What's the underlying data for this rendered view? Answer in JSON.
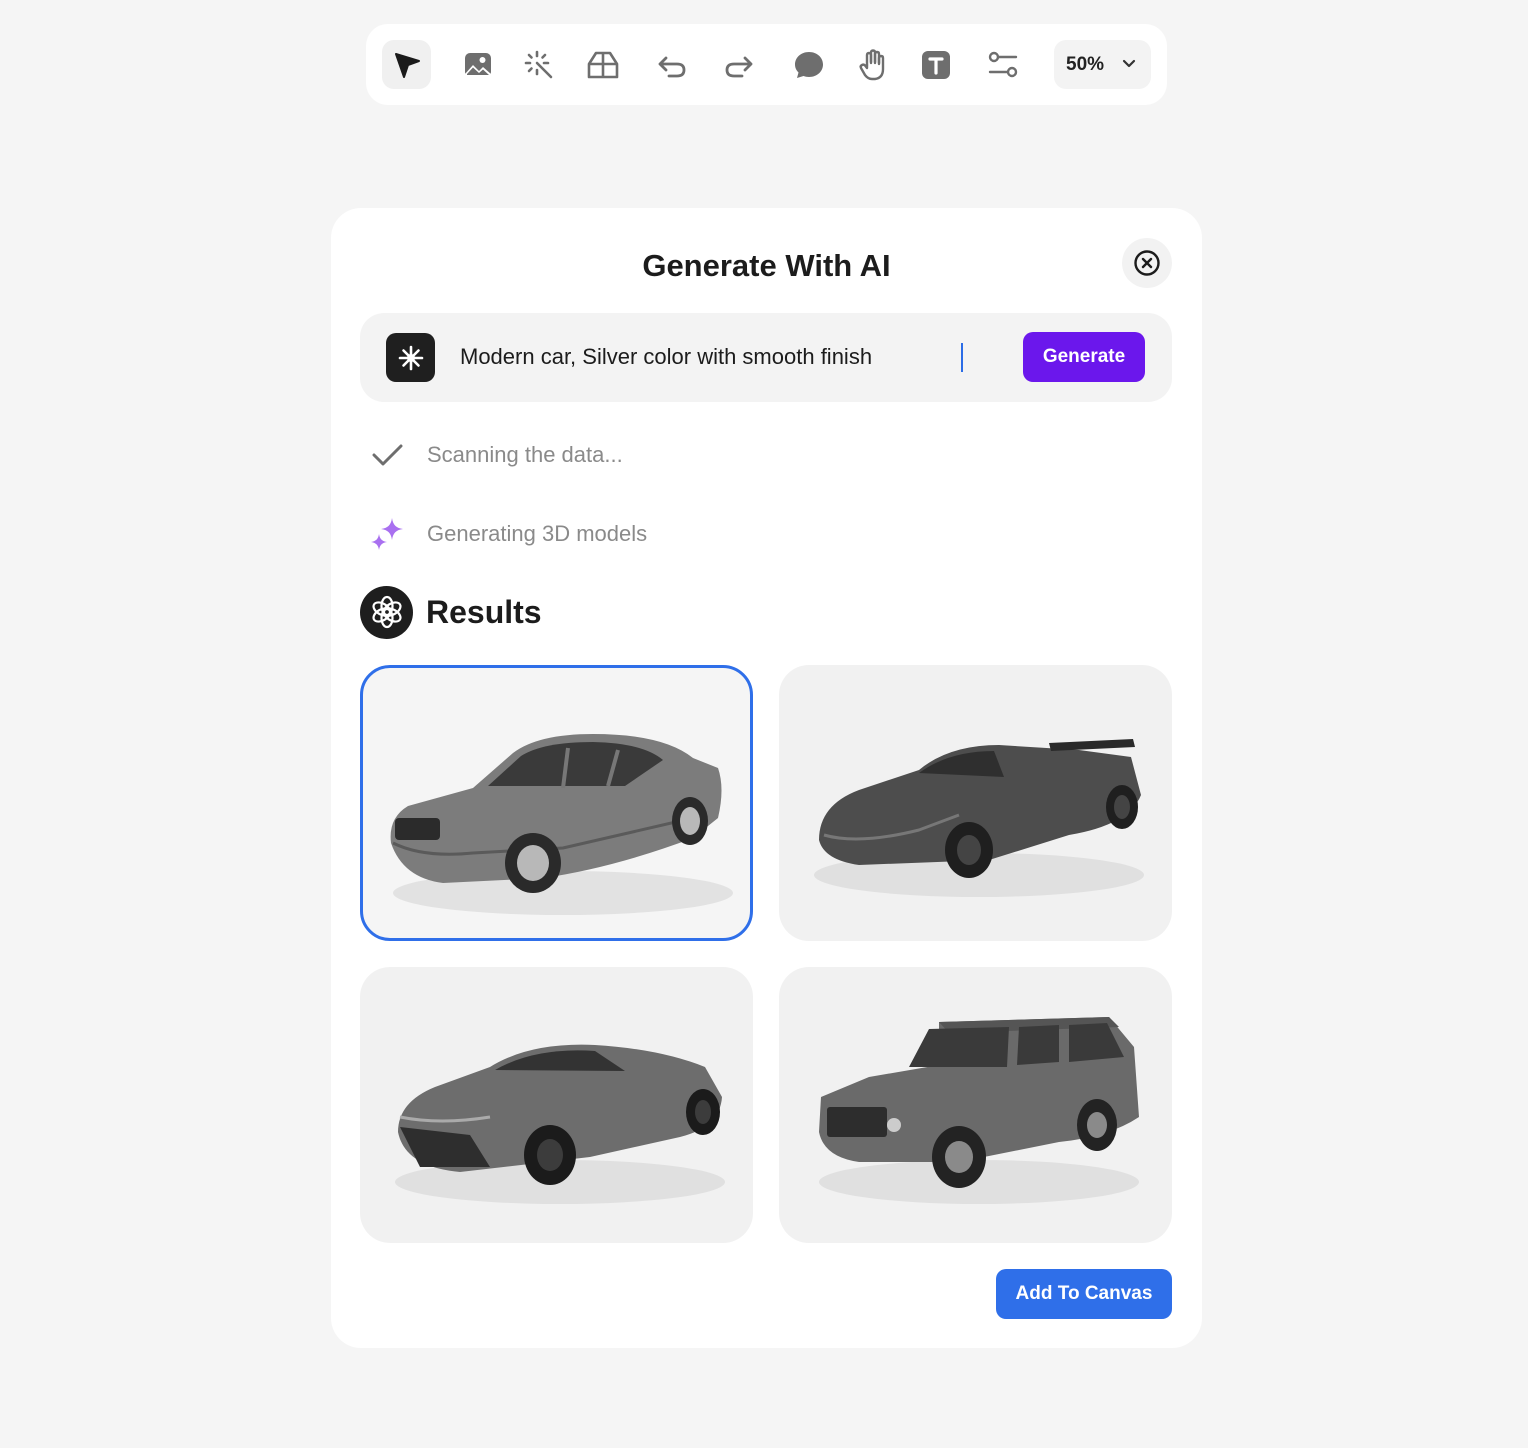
{
  "toolbar": {
    "tools": [
      {
        "name": "select-tool",
        "icon": "cursor-arrow-icon",
        "active": true
      },
      {
        "name": "image-tool",
        "icon": "image-icon"
      },
      {
        "name": "magic-tool",
        "icon": "magic-wand-icon"
      },
      {
        "name": "3d-tool",
        "icon": "3d-box-icon"
      },
      {
        "name": "undo-tool",
        "icon": "undo-icon"
      },
      {
        "name": "redo-tool",
        "icon": "redo-icon"
      },
      {
        "name": "comment-tool",
        "icon": "chat-bubble-icon"
      },
      {
        "name": "hand-tool",
        "icon": "hand-icon"
      },
      {
        "name": "text-tool",
        "icon": "text-icon"
      },
      {
        "name": "settings-tool",
        "icon": "sliders-icon"
      }
    ],
    "zoom": {
      "value": "50%",
      "icon": "chevron-down-icon"
    }
  },
  "dialog": {
    "title": "Generate With AI",
    "close_icon": "close-circle-icon",
    "prompt": {
      "icon": "asterisk-sparkle-icon",
      "value": "Modern car, Silver color with smooth finish",
      "generate_label": "Generate"
    },
    "status": [
      {
        "icon": "check-icon",
        "text": "Scanning the data..."
      },
      {
        "icon": "sparkles-icon",
        "text": "Generating 3D models"
      }
    ],
    "results": {
      "icon": "openai-logo-icon",
      "title": "Results",
      "items": [
        {
          "name": "sedan",
          "selected": true
        },
        {
          "name": "sports-roadster",
          "selected": false
        },
        {
          "name": "supercar-coupe",
          "selected": false
        },
        {
          "name": "classic-suv",
          "selected": false
        }
      ]
    },
    "add_label": "Add To Canvas"
  },
  "colors": {
    "background": "#f5f5f5",
    "generate": "#6b17ec",
    "accent_blue": "#2f6fe9",
    "sparkle": "#a970f0"
  }
}
